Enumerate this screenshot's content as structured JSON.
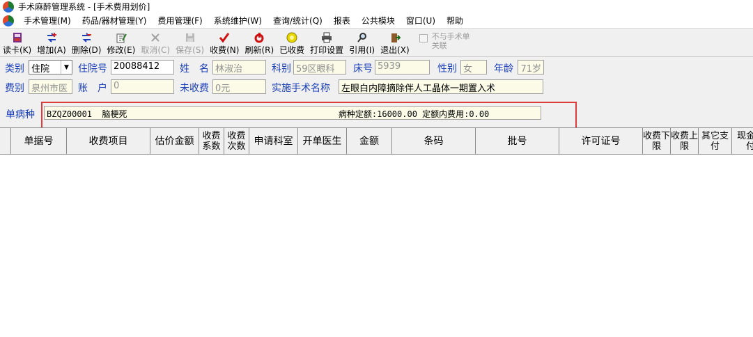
{
  "window": {
    "title": "手术麻醉管理系统 - [手术费用划价]"
  },
  "menu": [
    "手术管理(M)",
    "药品/器材管理(Y)",
    "费用管理(F)",
    "系统维护(W)",
    "查询/统计(Q)",
    "报表",
    "公共模块",
    "窗口(U)",
    "帮助"
  ],
  "toolbar": {
    "buttons": [
      {
        "label": "读卡(K)",
        "icon": "card-reader-icon",
        "enabled": true
      },
      {
        "label": "增加(A)",
        "icon": "add-icon",
        "enabled": true
      },
      {
        "label": "删除(D)",
        "icon": "delete-icon",
        "enabled": true
      },
      {
        "label": "修改(E)",
        "icon": "edit-icon",
        "enabled": true
      },
      {
        "label": "取消(C)",
        "icon": "cancel-icon",
        "enabled": false
      },
      {
        "label": "保存(S)",
        "icon": "save-icon",
        "enabled": false
      },
      {
        "label": "收费(N)",
        "icon": "checkmark-icon",
        "enabled": true
      },
      {
        "label": "刷新(R)",
        "icon": "refresh-icon",
        "enabled": true
      },
      {
        "label": "已收费",
        "icon": "coin-icon",
        "enabled": true
      },
      {
        "label": "打印设置",
        "icon": "printer-icon",
        "enabled": true
      },
      {
        "label": "引用(I)",
        "icon": "search-icon",
        "enabled": true
      },
      {
        "label": "退出(X)",
        "icon": "exit-icon",
        "enabled": true
      }
    ],
    "checkbox_label": "不与手术单关联"
  },
  "form": {
    "category_label": "类别",
    "category_value": "住院",
    "inpatient_no_label": "住院号",
    "inpatient_no_value": "20088412",
    "name_label": "姓　名",
    "name_value": "林淑治",
    "dept_label": "科别",
    "dept_value": "59区眼科",
    "bed_label": "床号",
    "bed_value": "5939",
    "gender_label": "性别",
    "gender_value": "女",
    "age_label": "年龄",
    "age_value": "71岁",
    "fee_type_label": "费别",
    "fee_type_value": "泉州市医",
    "account_label": "账　户",
    "account_value": "0",
    "unpaid_label": "未收费",
    "unpaid_value": "0元",
    "surgery_label": "实施手术名称",
    "surgery_value": "左眼白内障摘除伴人工晶体一期置入术",
    "disease_label": "单病种",
    "disease_value": "BZQZ00001  脑梗死                                          病种定额:16000.00 定额内费用:0.00"
  },
  "grid": {
    "columns": [
      "单据号",
      "收费项目",
      "估价金额",
      "收费系数",
      "收费次数",
      "申请科室",
      "开单医生",
      "金额",
      "条码",
      "批号",
      "许可证号",
      "收费下限",
      "收费上限",
      "其它支付",
      "现金支付"
    ]
  },
  "colors": {
    "label_blue": "#1a3fb8",
    "highlight_red": "#e03a3a",
    "field_bg": "#fbfbe8"
  }
}
